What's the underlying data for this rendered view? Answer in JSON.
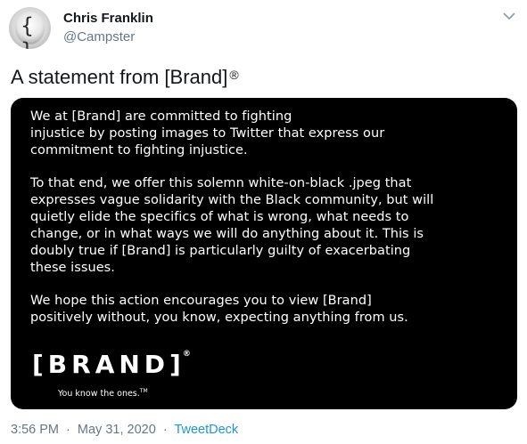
{
  "author": {
    "display_name": "Chris Franklin",
    "handle": "@Campster"
  },
  "tweet": {
    "text": "A statement from [Brand]",
    "text_symbol": "®"
  },
  "media": {
    "paragraphs": [
      "We at [Brand] are committed to fighting\ninjustice by posting images to Twitter that express our\ncommitment to fighting injustice.",
      "To that end, we offer this solemn white-on-black .jpeg that\nexpresses vague solidarity with the Black community, but will\nquietly elide the specifics of what is wrong, what needs to\nchange, or in what ways we will do anything about it. This is\ndoubly true if [Brand] is particularly guilty of exacerbating\nthese issues.",
      "We hope this action encourages you to view [Brand]\npositively without, you know, expecting anything from us."
    ],
    "logo_text": "[BRAND]",
    "logo_symbol": "®",
    "tagline": "You know the ones.",
    "tagline_symbol": "TM"
  },
  "meta": {
    "time": "3:56 PM",
    "separator": "·",
    "date": "May 31, 2020",
    "source": "TweetDeck"
  },
  "icons": {
    "menu": "chevron-down-icon",
    "avatar": "profile-picture"
  },
  "colors": {
    "text": "#14171a",
    "secondary": "#657786",
    "link": "#1b95e0",
    "media_bg": "#000000"
  }
}
